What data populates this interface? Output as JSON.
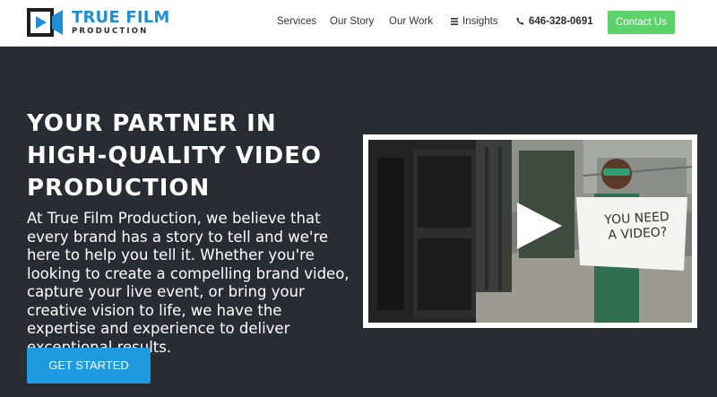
{
  "brand": {
    "title": "TRUE FILM",
    "subtitle": "PRODUCTION",
    "accent": "#1e8fd4"
  },
  "nav": {
    "items": [
      "Services",
      "Our Story",
      "Our Work",
      "Insights"
    ],
    "phone": "646-328-0691",
    "contact_label": "Contact Us",
    "contact_color": "#5bd36a"
  },
  "hero": {
    "title": "YOUR PARTNER IN HIGH-QUALITY VIDEO PRODUCTION",
    "text": "At True Film Production, we believe that every brand has a story to tell and we're here to help you tell it. Whether you're looking to create a compelling brand video, capture your live event, or bring your creative vision to life, we have the expertise and experience to deliver exceptional results.",
    "cta_label": "GET STARTED",
    "cta_color": "#1e9ae0",
    "background": "#2a2c33"
  },
  "video": {
    "sign_line1": "YOU NEED",
    "sign_line2": "A VIDEO?",
    "play_icon": "play-icon"
  }
}
